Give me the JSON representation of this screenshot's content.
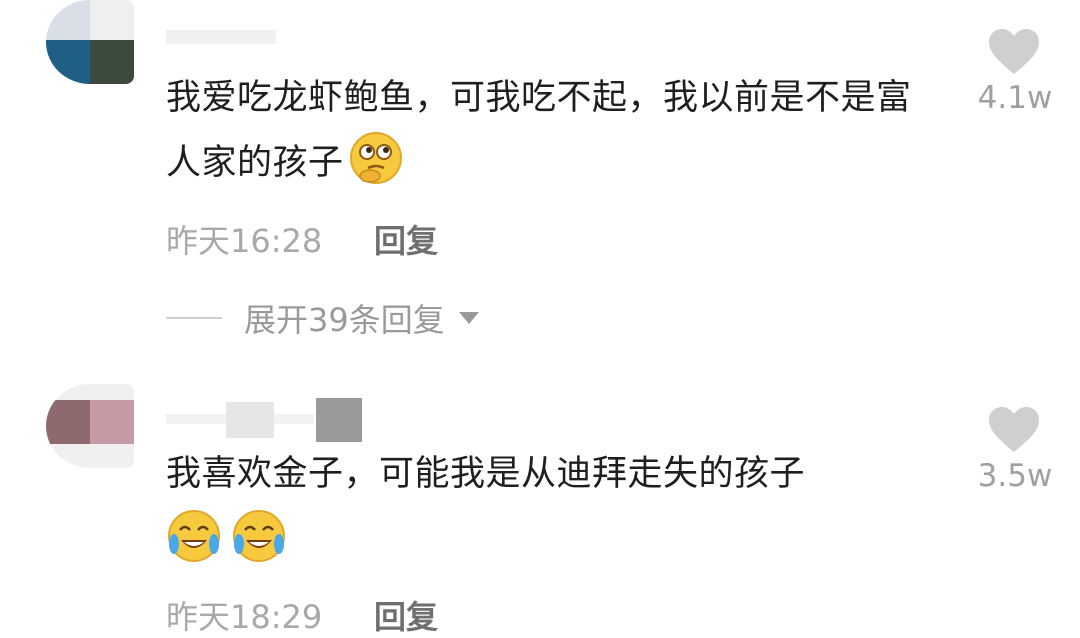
{
  "comments": [
    {
      "text": "我爱吃龙虾鲍鱼，可我吃不起，我以前是不是富人家的孩子",
      "emoji": [
        "thinking-face-emoji"
      ],
      "time": "昨天16:28",
      "reply_label": "回复",
      "like_count": "4.1w",
      "expand_label": "展开39条回复"
    },
    {
      "text": "我喜欢金子，可能我是从迪拜走失的孩子",
      "emoji": [
        "crying-laughing-emoji",
        "crying-laughing-emoji"
      ],
      "time": "昨天18:29",
      "reply_label": "回复",
      "like_count": "3.5w"
    }
  ],
  "colors": {
    "text": "#1f1f1f",
    "meta": "#a9a9a9",
    "heart": "#cfcfcf",
    "emoji_yellow": "#f7c93e"
  }
}
